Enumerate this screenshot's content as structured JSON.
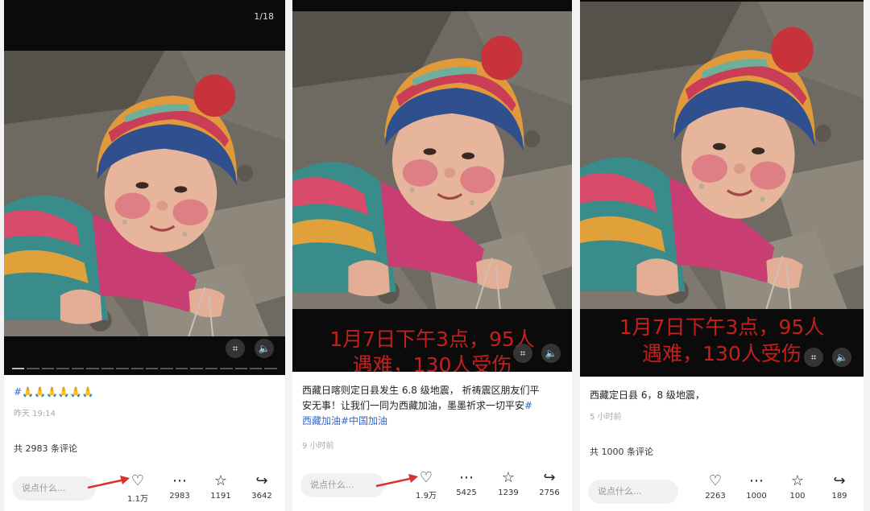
{
  "colors": {
    "hashtag": "#3367d6",
    "overlay_text": "#c4201e",
    "arrow": "#d93030"
  },
  "panels": [
    {
      "counter": "1/18",
      "caption_text": "#🙏🙏🙏🙏🙏🙏",
      "time": "昨天 19:14",
      "comments_text": "共 2983 条评论",
      "input_placeholder": "说点什么...",
      "actions": [
        {
          "icon": "heart-icon",
          "glyph": "♡",
          "count": "1.1万"
        },
        {
          "icon": "comment-icon",
          "glyph": "⋯",
          "count": "2983"
        },
        {
          "icon": "star-icon",
          "glyph": "☆",
          "count": "1191"
        },
        {
          "icon": "share-icon",
          "glyph": "↪",
          "count": "3642"
        }
      ]
    },
    {
      "overlay_line1": "1月7日下午3点，95人",
      "overlay_line2": "遇难，130人受伤",
      "caption_line1": "西藏日喀则定日县发生 6.8 级地震， 祈祷震区朋友们平",
      "caption_line2": "安无事！让我们一同为西藏加油，墨墨祈求一切平安",
      "caption_tag1": "#",
      "caption_tag2": "西藏加油#中国加油",
      "time": "9 小时前",
      "input_placeholder": "说点什么...",
      "actions": [
        {
          "icon": "heart-icon",
          "glyph": "♡",
          "count": "1.9万"
        },
        {
          "icon": "comment-icon",
          "glyph": "⋯",
          "count": "5425"
        },
        {
          "icon": "star-icon",
          "glyph": "☆",
          "count": "1239"
        },
        {
          "icon": "share-icon",
          "glyph": "↪",
          "count": "2756"
        }
      ]
    },
    {
      "overlay_line1": "1月7日下午3点，95人",
      "overlay_line2": "遇难，130人受伤",
      "caption_text": "西藏定日县 6，8 级地震，",
      "time": "5 小时前",
      "comments_text": "共 1000 条评论",
      "input_placeholder": "说点什么...",
      "actions": [
        {
          "icon": "heart-icon",
          "glyph": "♡",
          "count": "2263"
        },
        {
          "icon": "comment-icon",
          "glyph": "⋯",
          "count": "1000"
        },
        {
          "icon": "star-icon",
          "glyph": "☆",
          "count": "100"
        },
        {
          "icon": "share-icon",
          "glyph": "↪",
          "count": "189"
        }
      ]
    }
  ]
}
